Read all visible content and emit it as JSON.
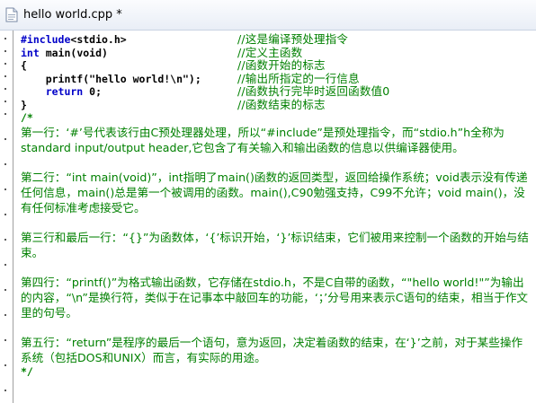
{
  "window": {
    "tab_title": "hello world.cpp *",
    "file_icon": "cpp-file-icon"
  },
  "code": {
    "lines": [
      {
        "prefix": "#include",
        "rest": "<stdio.h>",
        "comment": "//这是编译预处理指令"
      },
      {
        "prefix": "int",
        "rest": " main(void)",
        "comment": "//定义主函数"
      },
      {
        "prefix": "",
        "rest": "{",
        "comment": "//函数开始的标志"
      },
      {
        "prefix": "",
        "rest": "    printf(\"hello world!\\n\");",
        "comment": "//输出所指定的一行信息"
      },
      {
        "prefix": "    return",
        "rest": " 0;",
        "comment": "//函数执行完毕时返回函数值0"
      },
      {
        "prefix": "",
        "rest": "}",
        "comment": "//函数结束的标志"
      }
    ],
    "block_open": "/*",
    "block_close": "*/",
    "paragraphs": [
      "第一行：‘#’号代表该行由C预处理器处理，所以“#include”是预处理指令，而“stdio.h”h全称为standard input/output header,它包含了有关输入和输出函数的信息以供编译器使用。",
      "第二行：“int main(void)”，int指明了main()函数的返回类型，返回给操作系统；void表示没有传递任何信息，main()总是第一个被调用的函数。main(),C90勉强支持，C99不允许；void main()，没有任何标准考虑接受它。",
      "第三行和最后一行：“{}”为函数体，‘{’标识开始，‘}’标识结束，它们被用来控制一个函数的开始与结束。",
      "第四行：“printf()”为格式输出函数，它存储在stdio.h，不是C自带的函数，“\"hello world!\"”为输出的内容，“\\n”是换行符，类似于在记事本中敲回车的功能，‘；’分号用来表示C语句的结束，相当于作文里的句号。",
      "第五行：“return”是程序的最后一个语句，意为返回，决定着函数的结束，在‘}’之前，对于某些操作系统（包括DOS和UNIX）而言，有实际的用途。"
    ]
  },
  "colors": {
    "keyword": "#0000c8",
    "comment": "#008000",
    "code": "#000000"
  }
}
